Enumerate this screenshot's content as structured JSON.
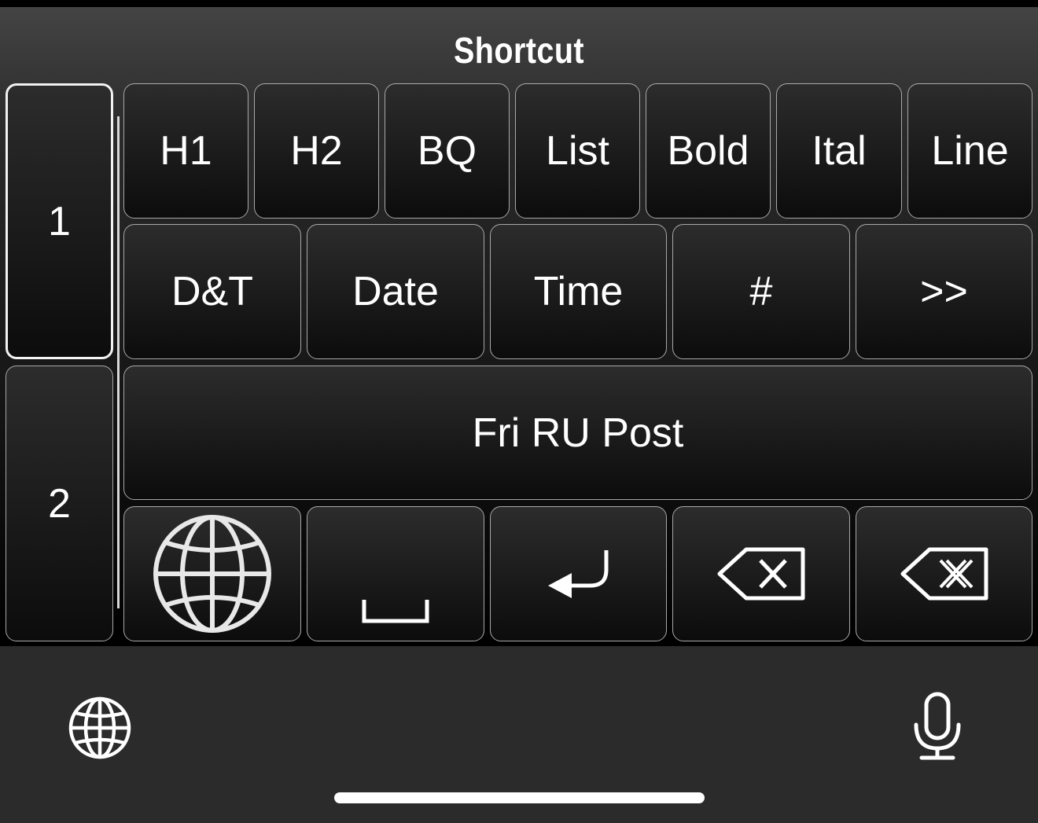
{
  "keyboard": {
    "title": "Shortcut",
    "pages": [
      "1",
      "2"
    ],
    "row1": [
      "H1",
      "H2",
      "BQ",
      "List",
      "Bold",
      "Ital",
      "Line"
    ],
    "row2": [
      "D&T",
      "Date",
      "Time",
      "#",
      ">>"
    ],
    "row3": [
      "Fri RU Post"
    ],
    "row4_icons": [
      "globe-icon",
      "space-bar-icon",
      "return-arrow-icon",
      "delete-backward-icon",
      "delete-word-icon"
    ]
  },
  "system_bar": {
    "left_icon": "globe-icon",
    "right_icon": "microphone-icon"
  }
}
